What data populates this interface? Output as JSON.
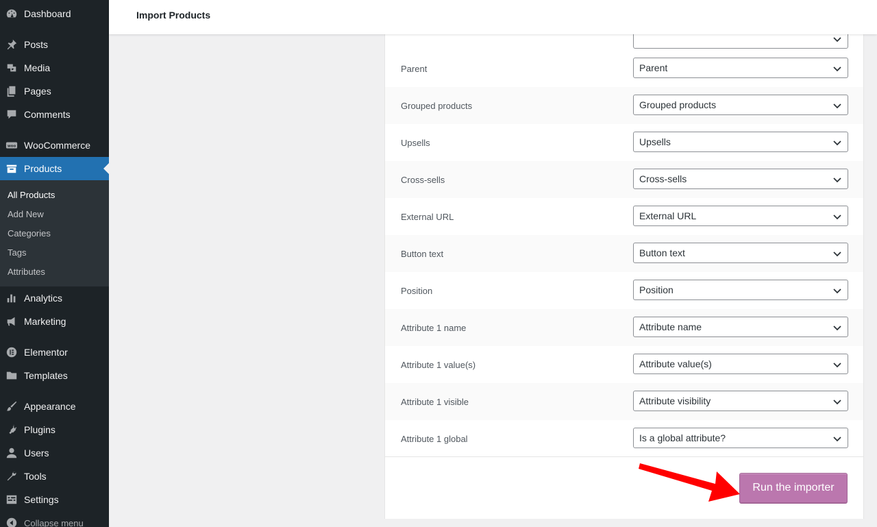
{
  "sidebar": {
    "items": [
      {
        "label": "Dashboard",
        "icon": "dashboard-icon"
      },
      {
        "label": "Posts",
        "icon": "pin-icon"
      },
      {
        "label": "Media",
        "icon": "media-icon"
      },
      {
        "label": "Pages",
        "icon": "pages-icon"
      },
      {
        "label": "Comments",
        "icon": "comments-icon"
      },
      {
        "label": "WooCommerce",
        "icon": "woo-icon"
      },
      {
        "label": "Products",
        "icon": "archive-icon"
      },
      {
        "label": "Analytics",
        "icon": "chart-bar-icon"
      },
      {
        "label": "Marketing",
        "icon": "megaphone-icon"
      },
      {
        "label": "Elementor",
        "icon": "elementor-icon"
      },
      {
        "label": "Templates",
        "icon": "folder-icon"
      },
      {
        "label": "Appearance",
        "icon": "brush-icon"
      },
      {
        "label": "Plugins",
        "icon": "plugin-icon"
      },
      {
        "label": "Users",
        "icon": "user-icon"
      },
      {
        "label": "Tools",
        "icon": "wrench-icon"
      },
      {
        "label": "Settings",
        "icon": "settings-icon"
      }
    ],
    "submenu": [
      "All Products",
      "Add New",
      "Categories",
      "Tags",
      "Attributes"
    ],
    "collapse_label": "Collapse menu"
  },
  "header": {
    "title": "Import Products"
  },
  "mapping": {
    "rows": [
      {
        "label": "Parent",
        "value": "Parent"
      },
      {
        "label": "Grouped products",
        "value": "Grouped products"
      },
      {
        "label": "Upsells",
        "value": "Upsells"
      },
      {
        "label": "Cross-sells",
        "value": "Cross-sells"
      },
      {
        "label": "External URL",
        "value": "External URL"
      },
      {
        "label": "Button text",
        "value": "Button text"
      },
      {
        "label": "Position",
        "value": "Position"
      },
      {
        "label": "Attribute 1 name",
        "value": "Attribute name"
      },
      {
        "label": "Attribute 1 value(s)",
        "value": "Attribute value(s)"
      },
      {
        "label": "Attribute 1 visible",
        "value": "Attribute visibility"
      },
      {
        "label": "Attribute 1 global",
        "value": "Is a global attribute?"
      }
    ]
  },
  "footer": {
    "run_label": "Run the importer"
  },
  "colors": {
    "accent": "#2271b1",
    "button": "#bb77ae",
    "arrow": "#ff0000",
    "sidebar": "#1d2327"
  }
}
